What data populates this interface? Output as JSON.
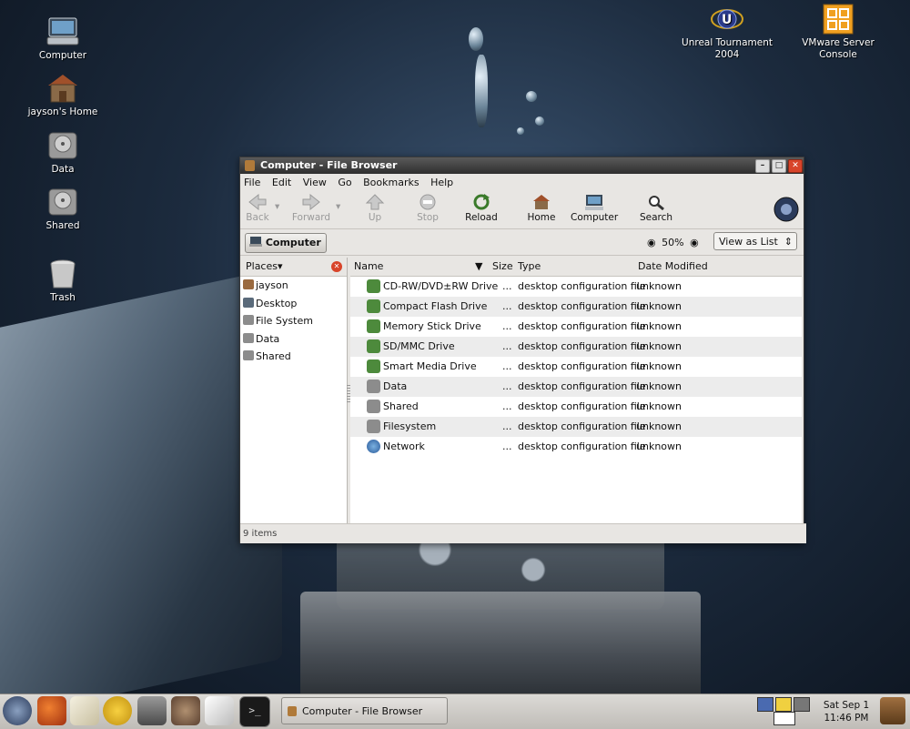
{
  "desktop": {
    "icons": [
      {
        "label": "Computer"
      },
      {
        "label": "jayson's Home"
      },
      {
        "label": "Data"
      },
      {
        "label": "Shared"
      },
      {
        "label": "Trash"
      },
      {
        "label": "Unreal Tournament 2004"
      },
      {
        "label": "VMware Server Console"
      }
    ]
  },
  "window": {
    "title": "Computer - File Browser",
    "menu": [
      "File",
      "Edit",
      "View",
      "Go",
      "Bookmarks",
      "Help"
    ],
    "toolbar": {
      "back": "Back",
      "forward": "Forward",
      "up": "Up",
      "stop": "Stop",
      "reload": "Reload",
      "home": "Home",
      "computer": "Computer",
      "search": "Search"
    },
    "location_button": "Computer",
    "zoom": "50%",
    "view_mode": "View as List",
    "places_label": "Places",
    "places": [
      "jayson",
      "Desktop",
      "File System",
      "Data",
      "Shared"
    ],
    "columns": {
      "name": "Name",
      "size": "Size",
      "type": "Type",
      "date": "Date Modified"
    },
    "files": [
      {
        "name": "CD-RW/DVD±RW Drive",
        "size": "...",
        "type": "desktop configuration file",
        "date": "unknown",
        "icon": "drive-icon"
      },
      {
        "name": "Compact Flash Drive",
        "size": "...",
        "type": "desktop configuration file",
        "date": "unknown",
        "icon": "drive-icon"
      },
      {
        "name": "Memory Stick Drive",
        "size": "...",
        "type": "desktop configuration file",
        "date": "unknown",
        "icon": "drive-icon"
      },
      {
        "name": "SD/MMC Drive",
        "size": "...",
        "type": "desktop configuration file",
        "date": "unknown",
        "icon": "drive-icon"
      },
      {
        "name": "Smart Media Drive",
        "size": "...",
        "type": "desktop configuration file",
        "date": "unknown",
        "icon": "drive-icon"
      },
      {
        "name": "Data",
        "size": "...",
        "type": "desktop configuration file",
        "date": "unknown",
        "icon": "harddisk-icon"
      },
      {
        "name": "Shared",
        "size": "...",
        "type": "desktop configuration file",
        "date": "unknown",
        "icon": "harddisk-icon"
      },
      {
        "name": "Filesystem",
        "size": "...",
        "type": "desktop configuration file",
        "date": "unknown",
        "icon": "harddisk-icon"
      },
      {
        "name": "Network",
        "size": "...",
        "type": "desktop configuration file",
        "date": "unknown",
        "icon": "network-globe-icon"
      }
    ],
    "status": "9 items"
  },
  "panel": {
    "task_label": "Computer - File Browser",
    "clock": {
      "date": "Sat Sep  1",
      "time": "11:46 PM"
    }
  },
  "colors": {
    "titlebar": "#2e2e2e",
    "close": "#d8442a",
    "drive": "#4d8a3c",
    "harddisk": "#8c8c8c"
  }
}
